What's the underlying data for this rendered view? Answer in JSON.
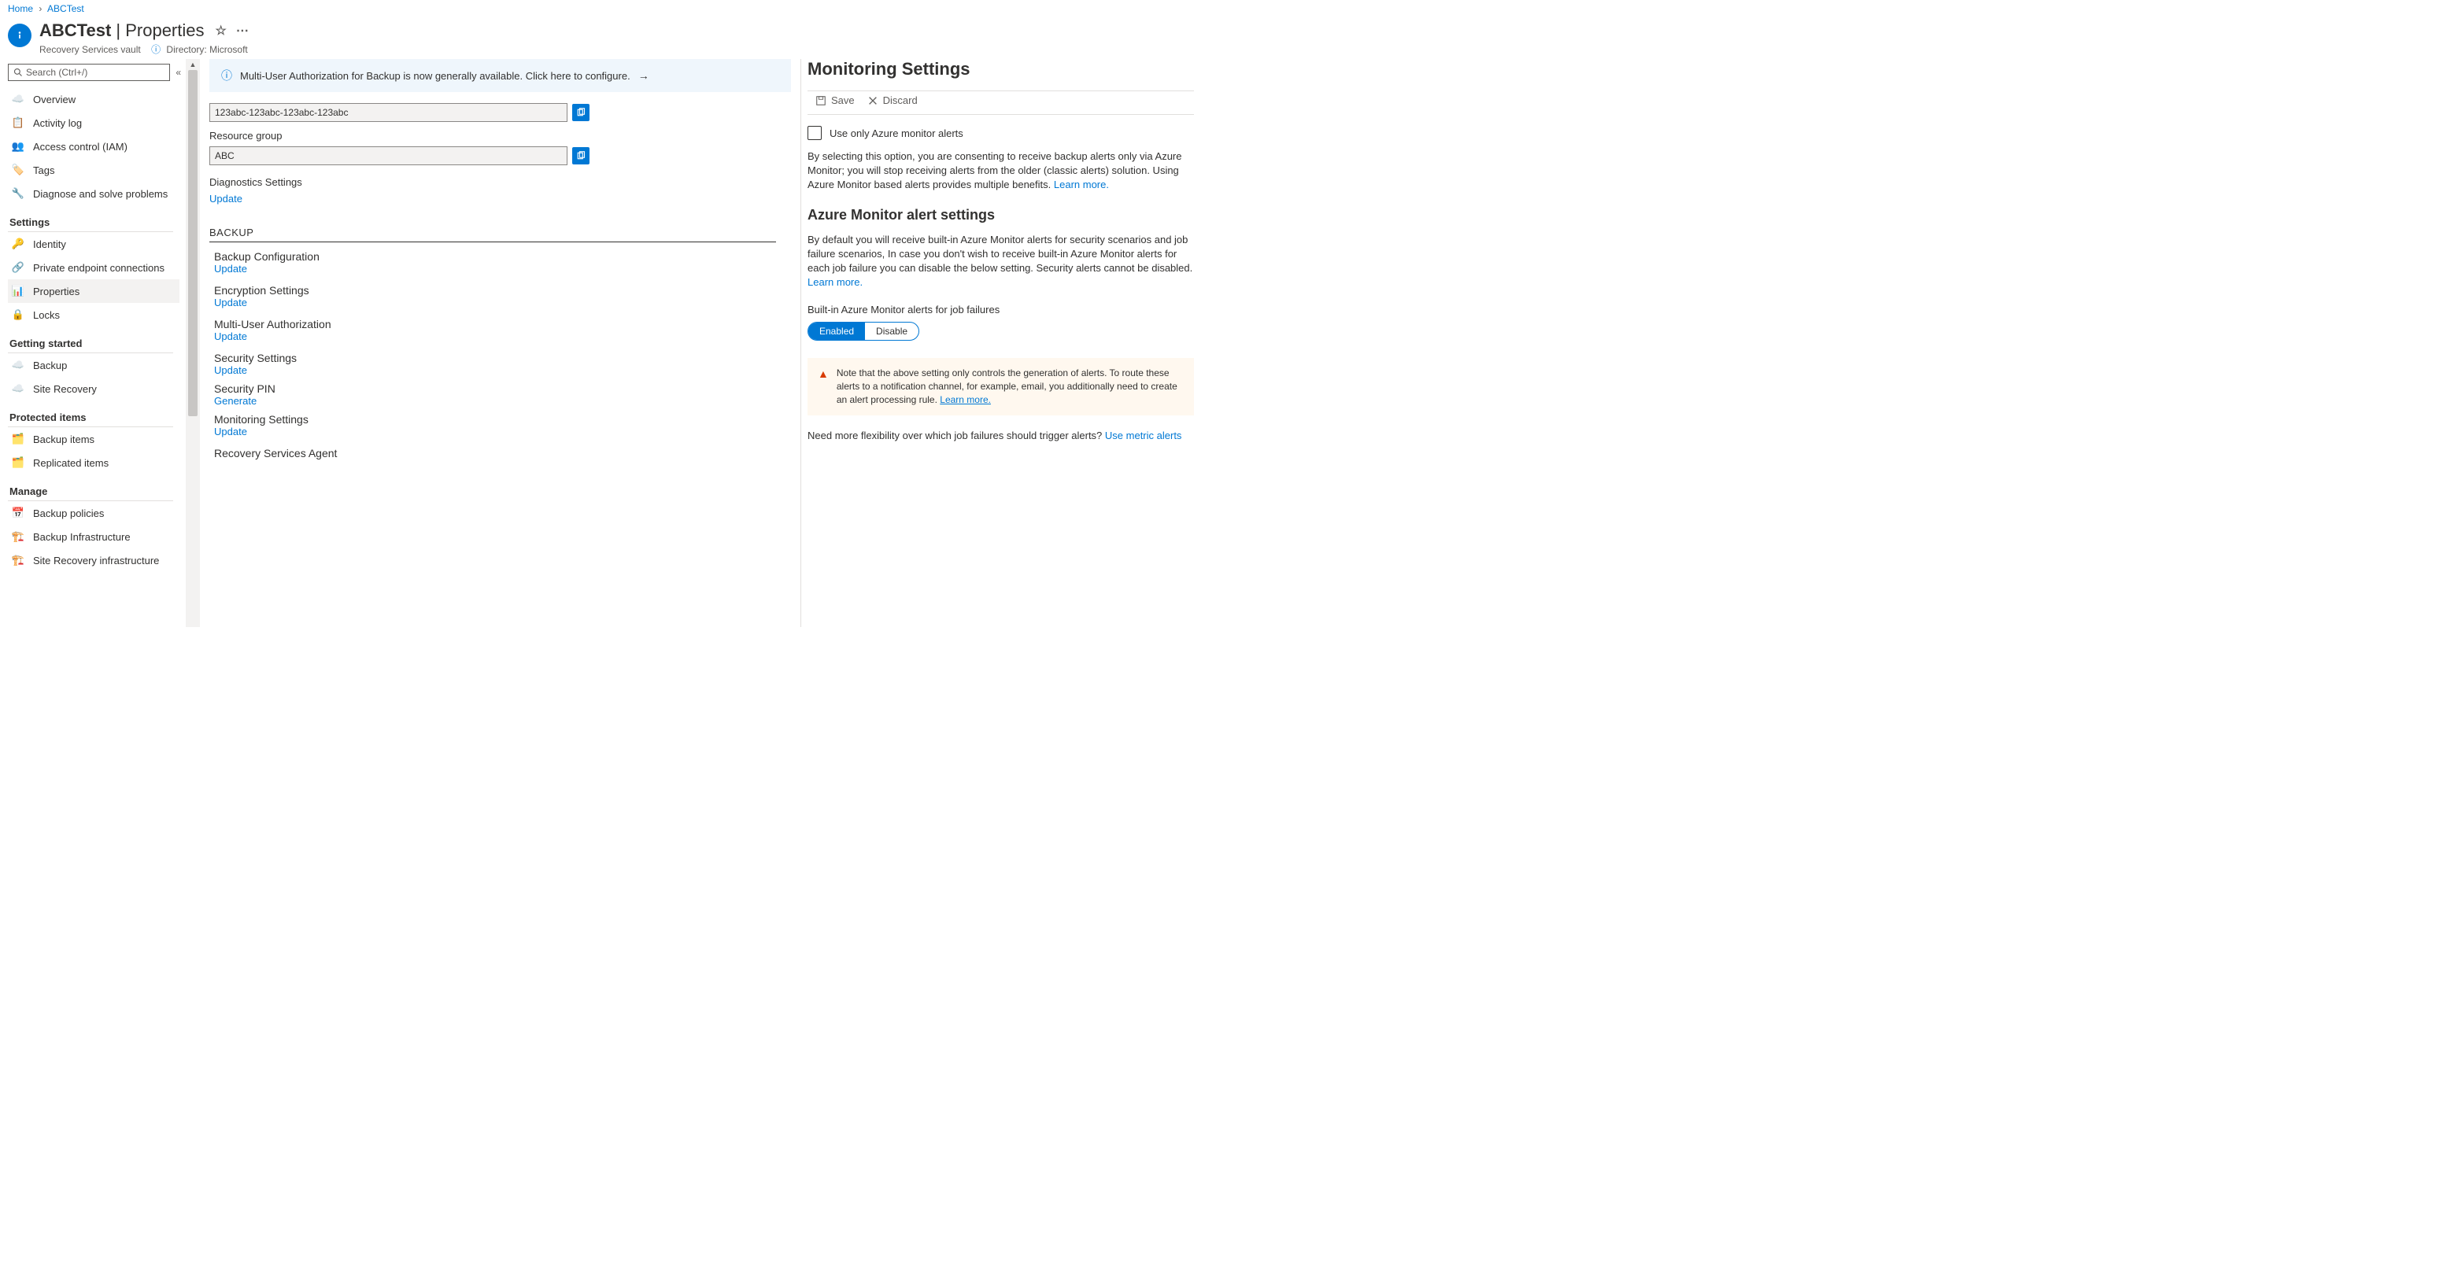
{
  "breadcrumb": {
    "home": "Home",
    "item": "ABCTest"
  },
  "header": {
    "title_left": "ABCTest",
    "title_right": "Properties",
    "subtitle": "Recovery Services vault",
    "directory_label": "Directory: Microsoft"
  },
  "search": {
    "placeholder": "Search (Ctrl+/)"
  },
  "sidebar": {
    "items": [
      {
        "label": "Overview"
      },
      {
        "label": "Activity log"
      },
      {
        "label": "Access control (IAM)"
      },
      {
        "label": "Tags"
      },
      {
        "label": "Diagnose and solve problems"
      }
    ],
    "settings_heading": "Settings",
    "settings_items": [
      {
        "label": "Identity"
      },
      {
        "label": "Private endpoint connections"
      },
      {
        "label": "Properties"
      },
      {
        "label": "Locks"
      }
    ],
    "getting_started_heading": "Getting started",
    "gs_items": [
      {
        "label": "Backup"
      },
      {
        "label": "Site Recovery"
      }
    ],
    "protected_heading": "Protected items",
    "protected_items": [
      {
        "label": "Backup items"
      },
      {
        "label": "Replicated items"
      }
    ],
    "manage_heading": "Manage",
    "manage_items": [
      {
        "label": "Backup policies"
      },
      {
        "label": "Backup Infrastructure"
      },
      {
        "label": "Site Recovery infrastructure"
      }
    ]
  },
  "banner": {
    "text": "Multi-User Authorization for Backup is now generally available. Click here to configure."
  },
  "content": {
    "id_value": "123abc-123abc-123abc-123abc",
    "rg_label": "Resource group",
    "rg_value": "ABC",
    "diag_label": "Diagnostics Settings",
    "update": "Update",
    "backup_section": "BACKUP",
    "blocks": [
      {
        "label": "Backup Configuration",
        "link": "Update"
      },
      {
        "label": "Encryption Settings",
        "link": "Update"
      },
      {
        "label": "Multi-User Authorization",
        "link": "Update"
      },
      {
        "label": "Security Settings",
        "link": "Update"
      },
      {
        "label": "Security PIN",
        "link": "Generate"
      },
      {
        "label": "Monitoring Settings",
        "link": "Update"
      },
      {
        "label": "Recovery Services Agent",
        "link": ""
      }
    ]
  },
  "panel": {
    "title": "Monitoring Settings",
    "save": "Save",
    "discard": "Discard",
    "checkbox_label": "Use only Azure monitor alerts",
    "para1": "By selecting this option, you are consenting to receive backup alerts only via Azure Monitor; you will stop receiving alerts from the older (classic alerts) solution. Using Azure Monitor based alerts provides multiple benefits. ",
    "learn_more": "Learn more.",
    "h3": "Azure Monitor alert settings",
    "para2": "By default you will receive built-in Azure Monitor alerts for security scenarios and job failure scenarios, In case you don't wish to receive built-in Azure Monitor alerts for each job failure you can disable the below setting. Security alerts cannot be disabled. ",
    "toggle_label": "Built-in Azure Monitor alerts for job failures",
    "enabled": "Enabled",
    "disable": "Disable",
    "note": "Note that the above setting only controls the generation of alerts. To route these alerts to a notification channel, for example, email, you additionally need to create an alert processing rule. ",
    "note_link": "Learn more.",
    "footer": "Need more flexibility over which job failures should trigger alerts? ",
    "footer_link": "Use metric alerts"
  }
}
